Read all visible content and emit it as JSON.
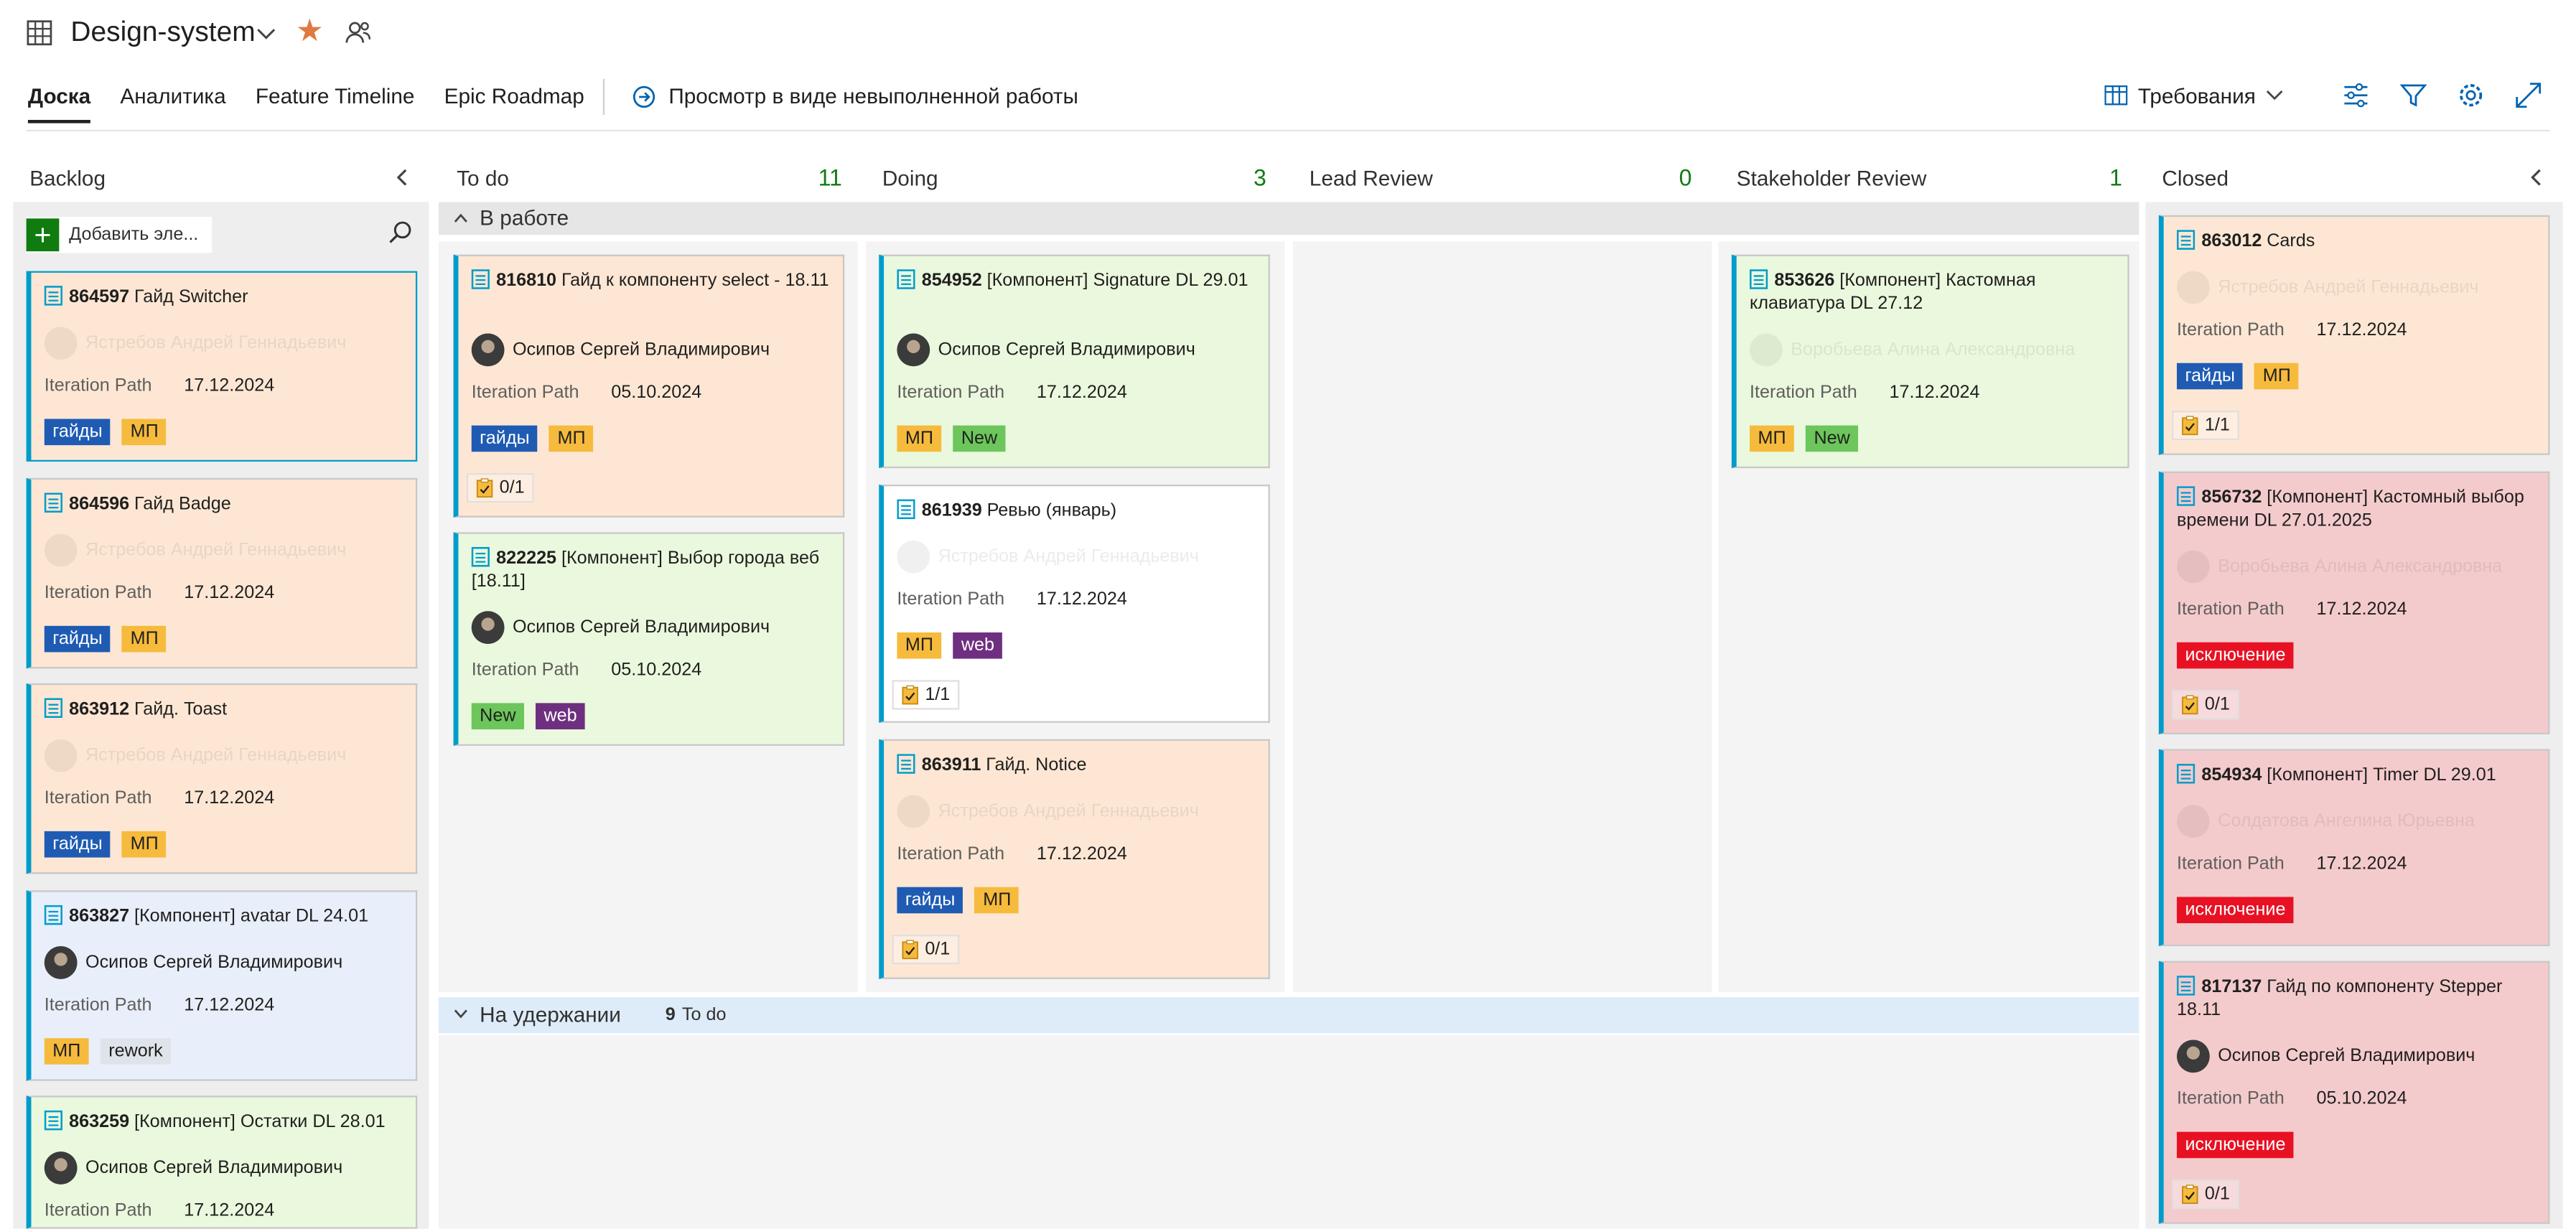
{
  "header": {
    "project": "Design-system",
    "tabs": [
      "Доска",
      "Аналитика",
      "Feature Timeline",
      "Epic Roadmap"
    ],
    "backlog_view": "Просмотр в виде невыполненной работы",
    "requirements": "Требования"
  },
  "columns": {
    "backlog": {
      "title": "Backlog"
    },
    "todo": {
      "title": "To do",
      "count": "11"
    },
    "doing": {
      "title": "Doing",
      "count": "3"
    },
    "lead": {
      "title": "Lead Review",
      "count": "0"
    },
    "stake": {
      "title": "Stakeholder Review",
      "count": "1"
    },
    "closed": {
      "title": "Closed"
    }
  },
  "swimlanes": {
    "working": "В работе",
    "hold": "На удержании",
    "hold_count": "9",
    "hold_state": "To do"
  },
  "backlog_add": "Добавить эле...",
  "labels": {
    "iteration": "Iteration Path"
  },
  "cards": {
    "b1": {
      "id": "864597",
      "title": "Гайд Switcher",
      "assignee": "Ястребов Андрей Геннадьевич",
      "date": "17.12.2024",
      "tags": [
        "гайды",
        "МП"
      ]
    },
    "b2": {
      "id": "864596",
      "title": "Гайд Badge",
      "assignee": "Ястребов Андрей Геннадьевич",
      "date": "17.12.2024",
      "tags": [
        "гайды",
        "МП"
      ]
    },
    "b3": {
      "id": "863912",
      "title": "Гайд. Toast",
      "assignee": "Ястребов Андрей Геннадьевич",
      "date": "17.12.2024",
      "tags": [
        "гайды",
        "МП"
      ]
    },
    "b4": {
      "id": "863827",
      "title": "[Компонент] avatar DL 24.01",
      "assignee": "Осипов Сергей Владимирович",
      "date": "17.12.2024",
      "tags": [
        "МП",
        "rework"
      ]
    },
    "b5": {
      "id": "863259",
      "title": "[Компонент] Остатки DL 28.01",
      "assignee": "Осипов Сергей Владимирович",
      "date": "17.12.2024"
    },
    "t1": {
      "id": "816810",
      "title": "Гайд к компоненту select - 18.11",
      "assignee": "Осипов Сергей Владимирович",
      "date": "05.10.2024",
      "tags": [
        "гайды",
        "МП"
      ],
      "check": "0/1"
    },
    "t2": {
      "id": "822225",
      "title": "[Компонент] Выбор города веб [18.11]",
      "assignee": "Осипов Сергей Владимирович",
      "date": "05.10.2024",
      "tags": [
        "New",
        "web"
      ]
    },
    "d1": {
      "id": "854952",
      "title": "[Компонент] Signature DL 29.01",
      "assignee": "Осипов Сергей Владимирович",
      "date": "17.12.2024",
      "tags": [
        "МП",
        "New"
      ]
    },
    "d2": {
      "id": "861939",
      "title": "Ревью (январь)",
      "assignee": "Ястребов Андрей Геннадьевич",
      "date": "17.12.2024",
      "tags": [
        "МП",
        "web"
      ],
      "check": "1/1"
    },
    "d3": {
      "id": "863911",
      "title": "Гайд. Notice",
      "assignee": "Ястребов Андрей Геннадьевич",
      "date": "17.12.2024",
      "tags": [
        "гайды",
        "МП"
      ],
      "check": "0/1"
    },
    "s1": {
      "id": "853626",
      "title": "[Компонент] Кастомная клавиатура DL 27.12",
      "assignee": "Воробьева Алина Александровна",
      "date": "17.12.2024",
      "tags": [
        "МП",
        "New"
      ]
    },
    "c1": {
      "id": "863012",
      "title": "Cards",
      "assignee": "Ястребов Андрей Геннадьевич",
      "date": "17.12.2024",
      "tags": [
        "гайды",
        "МП"
      ],
      "check": "1/1"
    },
    "c2": {
      "id": "856732",
      "title": "[Компонент] Кастомный выбор времени DL 27.01.2025",
      "assignee": "Воробьева Алина Александровна",
      "date": "17.12.2024",
      "tags": [
        "исключение"
      ],
      "check": "0/1"
    },
    "c3": {
      "id": "854934",
      "title": "[Компонент] Timer DL 29.01",
      "assignee": "Солдатова Ангелина Юрьевна",
      "date": "17.12.2024",
      "tags": [
        "исключение"
      ]
    },
    "c4": {
      "id": "817137",
      "title": "Гайд по компоненту Stepper 18.11",
      "assignee": "Осипов Сергей Владимирович",
      "date": "05.10.2024",
      "tags": [
        "исключение"
      ],
      "check": "0/1"
    }
  },
  "colors": {
    "accent": "#009ccc",
    "count_green": "#107c10",
    "star": "#e07a3f"
  }
}
